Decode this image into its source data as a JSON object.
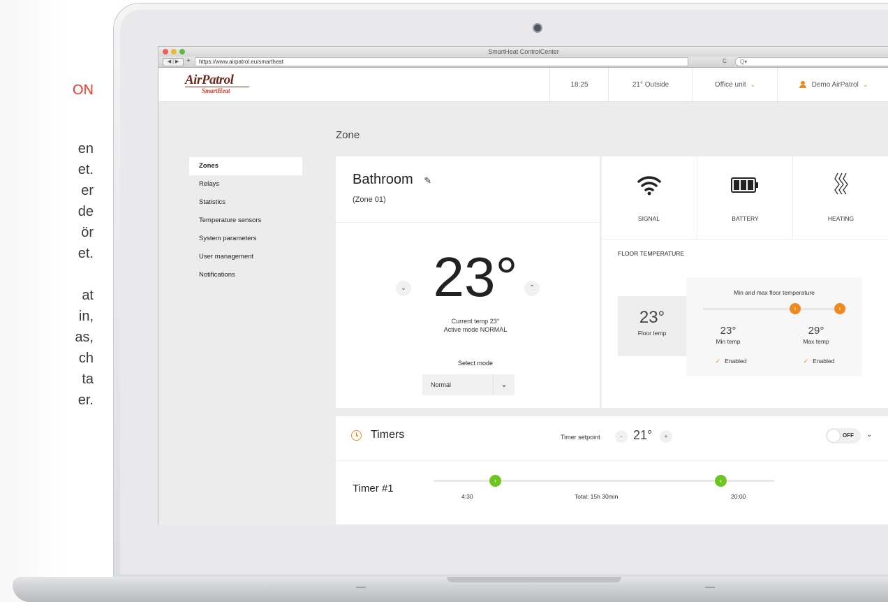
{
  "side_text": {
    "heading_fragment": "ON",
    "lines": [
      "en",
      "et.",
      "er",
      "de",
      "ör",
      "et.",
      "at",
      "in,",
      "as,",
      "ch",
      "ta",
      "er."
    ]
  },
  "browser": {
    "window_title": "SmartHeat ControlCenter",
    "nav_buttons": "◀ | ▶",
    "new_tab": "+",
    "url": "https://www.airpatrol.eu/smartheat",
    "reload": "C",
    "search_placeholder": "Q▾"
  },
  "header": {
    "logo_brand": "AirPatrol",
    "logo_sub": "SmartHeat",
    "time": "18:25",
    "outside_temp": "21° Outside",
    "unit_selector": "Office unit",
    "user_name": "Demo AirPatrol"
  },
  "page": {
    "title": "Zone"
  },
  "sidebar": {
    "items": [
      {
        "label": "Zones",
        "active": true
      },
      {
        "label": "Relays"
      },
      {
        "label": "Statistics"
      },
      {
        "label": "Temperature sensors"
      },
      {
        "label": "System parameters"
      },
      {
        "label": "User management"
      },
      {
        "label": "Notifications"
      }
    ]
  },
  "zone": {
    "name": "Bathroom",
    "code": "(Zone 01)",
    "set_temp": "23°",
    "current_temp_text": "Current temp 23°",
    "active_mode_text": "Active mode NORMAL",
    "select_mode_label": "Select mode",
    "selected_mode": "Normal"
  },
  "status": {
    "signal_label": "SIGNAL",
    "battery_label": "BATTERY",
    "heating_label": "HEATING"
  },
  "floor": {
    "title": "FLOOR TEMPERATURE",
    "temp": "23°",
    "temp_label": "Floor temp",
    "minmax_title": "Min and max floor temperature",
    "min_temp": "23°",
    "min_label": "Min temp",
    "max_temp": "29°",
    "max_label": "Max temp",
    "min_enabled": "Enabled",
    "max_enabled": "Enabled",
    "min_fraction": 0.66,
    "max_fraction": 0.98
  },
  "timers": {
    "title": "Timers",
    "setpoint_label": "Timer setpoint",
    "setpoint_minus": "-",
    "setpoint_value": "21°",
    "setpoint_plus": "+",
    "toggle_state": "OFF",
    "timer1": {
      "name": "Timer #1",
      "start": "4:30",
      "total": "Total: 15h 30min",
      "end": "20:00"
    }
  },
  "colors": {
    "accent_orange": "#ef8a1f",
    "timer_green": "#6cc521",
    "brand_brown": "#6d2c1e",
    "brand_red": "#d43a25"
  }
}
